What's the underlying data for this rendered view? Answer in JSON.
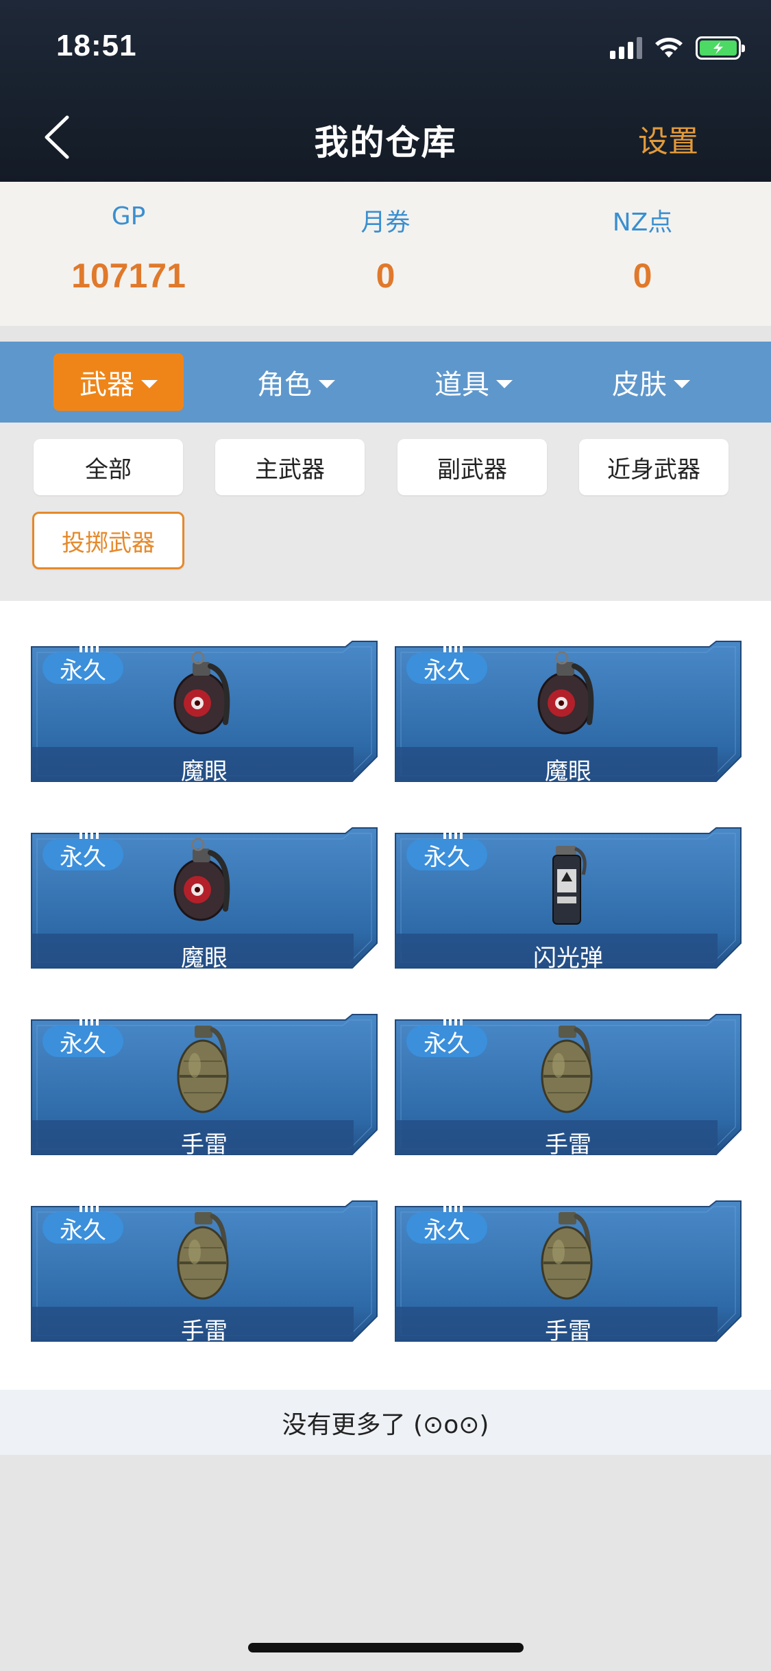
{
  "status_bar": {
    "time": "18:51"
  },
  "header": {
    "title": "我的仓库",
    "settings_label": "设置"
  },
  "currency": [
    {
      "label": "GP",
      "value": "107171"
    },
    {
      "label": "月券",
      "value": "0"
    },
    {
      "label": "NZ点",
      "value": "0"
    }
  ],
  "categories": [
    {
      "label": "武器",
      "active": true
    },
    {
      "label": "角色",
      "active": false
    },
    {
      "label": "道具",
      "active": false
    },
    {
      "label": "皮肤",
      "active": false
    }
  ],
  "sub_filters": [
    {
      "label": "全部"
    },
    {
      "label": "主武器"
    },
    {
      "label": "副武器"
    },
    {
      "label": "近身武器"
    },
    {
      "label": "投掷武器",
      "selected": true
    }
  ],
  "items": [
    {
      "badge": "永久",
      "name": "魔眼",
      "icon": "demon-eye-grenade-icon"
    },
    {
      "badge": "永久",
      "name": "魔眼",
      "icon": "demon-eye-grenade-icon"
    },
    {
      "badge": "永久",
      "name": "魔眼",
      "icon": "demon-eye-grenade-icon"
    },
    {
      "badge": "永久",
      "name": "闪光弹",
      "icon": "flashbang-icon"
    },
    {
      "badge": "永久",
      "name": "手雷",
      "icon": "frag-grenade-icon"
    },
    {
      "badge": "永久",
      "name": "手雷",
      "icon": "frag-grenade-icon"
    },
    {
      "badge": "永久",
      "name": "手雷",
      "icon": "frag-grenade-icon"
    },
    {
      "badge": "永久",
      "name": "手雷",
      "icon": "frag-grenade-icon"
    }
  ],
  "footer": {
    "no_more_text": "没有更多了 (⊙o⊙)"
  },
  "colors": {
    "accent": "#ef8518",
    "category_bar": "#5e97cc",
    "label_blue": "#3a8fd0",
    "value_orange": "#e0792b",
    "settings": "#e39a3b"
  }
}
